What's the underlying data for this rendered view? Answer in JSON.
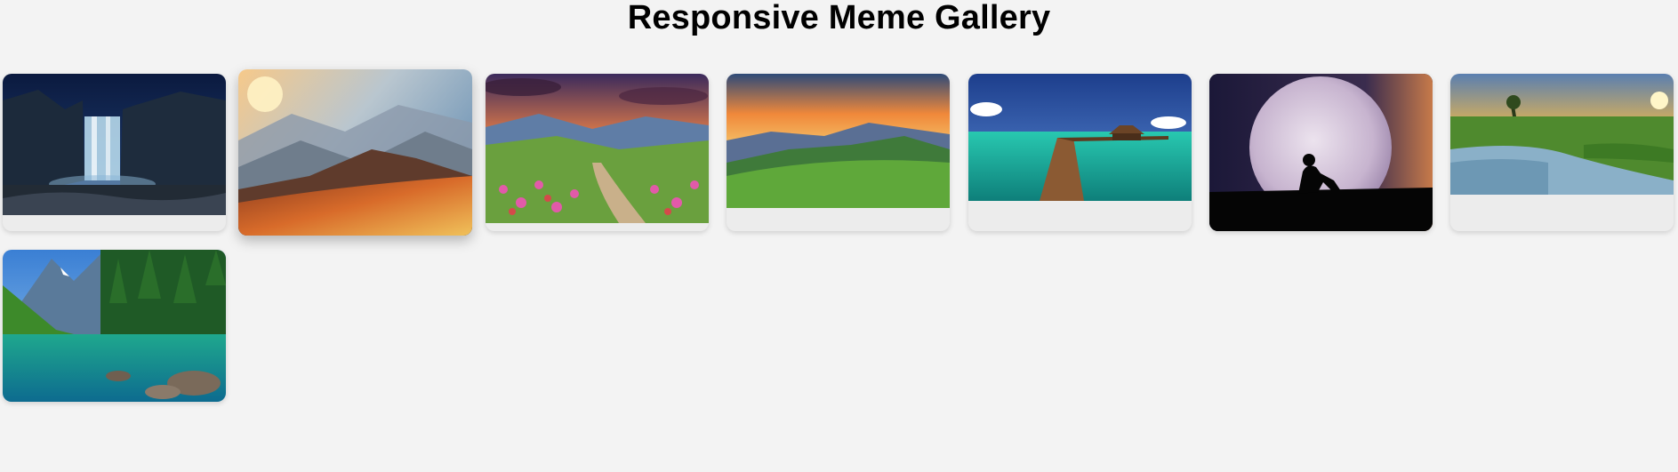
{
  "header": {
    "title": "Responsive Meme Gallery"
  },
  "gallery": {
    "items": [
      {
        "subject": "waterfall at night",
        "accent": "#1b3a6b"
      },
      {
        "subject": "sunset mountains golden slopes",
        "accent": "#e0a04a"
      },
      {
        "subject": "flower meadow path",
        "accent": "#a35ca8"
      },
      {
        "subject": "green hills at sunset",
        "accent": "#4f9a3a"
      },
      {
        "subject": "wooden pier over lagoon",
        "accent": "#1dbca0"
      },
      {
        "subject": "silhouette reading under full moon",
        "accent": "#b8a7c9"
      },
      {
        "subject": "river wetland at sunrise",
        "accent": "#e3b13c"
      },
      {
        "subject": "mountain lake with forest",
        "accent": "#22a36e"
      }
    ]
  }
}
